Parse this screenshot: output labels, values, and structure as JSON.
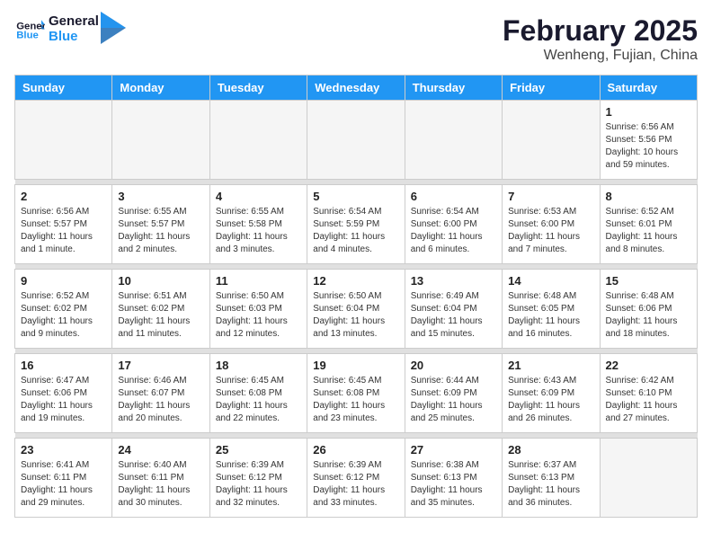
{
  "header": {
    "logo_general": "General",
    "logo_blue": "Blue",
    "month_year": "February 2025",
    "location": "Wenheng, Fujian, China"
  },
  "weekdays": [
    "Sunday",
    "Monday",
    "Tuesday",
    "Wednesday",
    "Thursday",
    "Friday",
    "Saturday"
  ],
  "weeks": [
    [
      {
        "day": "",
        "info": ""
      },
      {
        "day": "",
        "info": ""
      },
      {
        "day": "",
        "info": ""
      },
      {
        "day": "",
        "info": ""
      },
      {
        "day": "",
        "info": ""
      },
      {
        "day": "",
        "info": ""
      },
      {
        "day": "1",
        "info": "Sunrise: 6:56 AM\nSunset: 5:56 PM\nDaylight: 10 hours\nand 59 minutes."
      }
    ],
    [
      {
        "day": "2",
        "info": "Sunrise: 6:56 AM\nSunset: 5:57 PM\nDaylight: 11 hours\nand 1 minute."
      },
      {
        "day": "3",
        "info": "Sunrise: 6:55 AM\nSunset: 5:57 PM\nDaylight: 11 hours\nand 2 minutes."
      },
      {
        "day": "4",
        "info": "Sunrise: 6:55 AM\nSunset: 5:58 PM\nDaylight: 11 hours\nand 3 minutes."
      },
      {
        "day": "5",
        "info": "Sunrise: 6:54 AM\nSunset: 5:59 PM\nDaylight: 11 hours\nand 4 minutes."
      },
      {
        "day": "6",
        "info": "Sunrise: 6:54 AM\nSunset: 6:00 PM\nDaylight: 11 hours\nand 6 minutes."
      },
      {
        "day": "7",
        "info": "Sunrise: 6:53 AM\nSunset: 6:00 PM\nDaylight: 11 hours\nand 7 minutes."
      },
      {
        "day": "8",
        "info": "Sunrise: 6:52 AM\nSunset: 6:01 PM\nDaylight: 11 hours\nand 8 minutes."
      }
    ],
    [
      {
        "day": "9",
        "info": "Sunrise: 6:52 AM\nSunset: 6:02 PM\nDaylight: 11 hours\nand 9 minutes."
      },
      {
        "day": "10",
        "info": "Sunrise: 6:51 AM\nSunset: 6:02 PM\nDaylight: 11 hours\nand 11 minutes."
      },
      {
        "day": "11",
        "info": "Sunrise: 6:50 AM\nSunset: 6:03 PM\nDaylight: 11 hours\nand 12 minutes."
      },
      {
        "day": "12",
        "info": "Sunrise: 6:50 AM\nSunset: 6:04 PM\nDaylight: 11 hours\nand 13 minutes."
      },
      {
        "day": "13",
        "info": "Sunrise: 6:49 AM\nSunset: 6:04 PM\nDaylight: 11 hours\nand 15 minutes."
      },
      {
        "day": "14",
        "info": "Sunrise: 6:48 AM\nSunset: 6:05 PM\nDaylight: 11 hours\nand 16 minutes."
      },
      {
        "day": "15",
        "info": "Sunrise: 6:48 AM\nSunset: 6:06 PM\nDaylight: 11 hours\nand 18 minutes."
      }
    ],
    [
      {
        "day": "16",
        "info": "Sunrise: 6:47 AM\nSunset: 6:06 PM\nDaylight: 11 hours\nand 19 minutes."
      },
      {
        "day": "17",
        "info": "Sunrise: 6:46 AM\nSunset: 6:07 PM\nDaylight: 11 hours\nand 20 minutes."
      },
      {
        "day": "18",
        "info": "Sunrise: 6:45 AM\nSunset: 6:08 PM\nDaylight: 11 hours\nand 22 minutes."
      },
      {
        "day": "19",
        "info": "Sunrise: 6:45 AM\nSunset: 6:08 PM\nDaylight: 11 hours\nand 23 minutes."
      },
      {
        "day": "20",
        "info": "Sunrise: 6:44 AM\nSunset: 6:09 PM\nDaylight: 11 hours\nand 25 minutes."
      },
      {
        "day": "21",
        "info": "Sunrise: 6:43 AM\nSunset: 6:09 PM\nDaylight: 11 hours\nand 26 minutes."
      },
      {
        "day": "22",
        "info": "Sunrise: 6:42 AM\nSunset: 6:10 PM\nDaylight: 11 hours\nand 27 minutes."
      }
    ],
    [
      {
        "day": "23",
        "info": "Sunrise: 6:41 AM\nSunset: 6:11 PM\nDaylight: 11 hours\nand 29 minutes."
      },
      {
        "day": "24",
        "info": "Sunrise: 6:40 AM\nSunset: 6:11 PM\nDaylight: 11 hours\nand 30 minutes."
      },
      {
        "day": "25",
        "info": "Sunrise: 6:39 AM\nSunset: 6:12 PM\nDaylight: 11 hours\nand 32 minutes."
      },
      {
        "day": "26",
        "info": "Sunrise: 6:39 AM\nSunset: 6:12 PM\nDaylight: 11 hours\nand 33 minutes."
      },
      {
        "day": "27",
        "info": "Sunrise: 6:38 AM\nSunset: 6:13 PM\nDaylight: 11 hours\nand 35 minutes."
      },
      {
        "day": "28",
        "info": "Sunrise: 6:37 AM\nSunset: 6:13 PM\nDaylight: 11 hours\nand 36 minutes."
      },
      {
        "day": "",
        "info": ""
      }
    ]
  ]
}
